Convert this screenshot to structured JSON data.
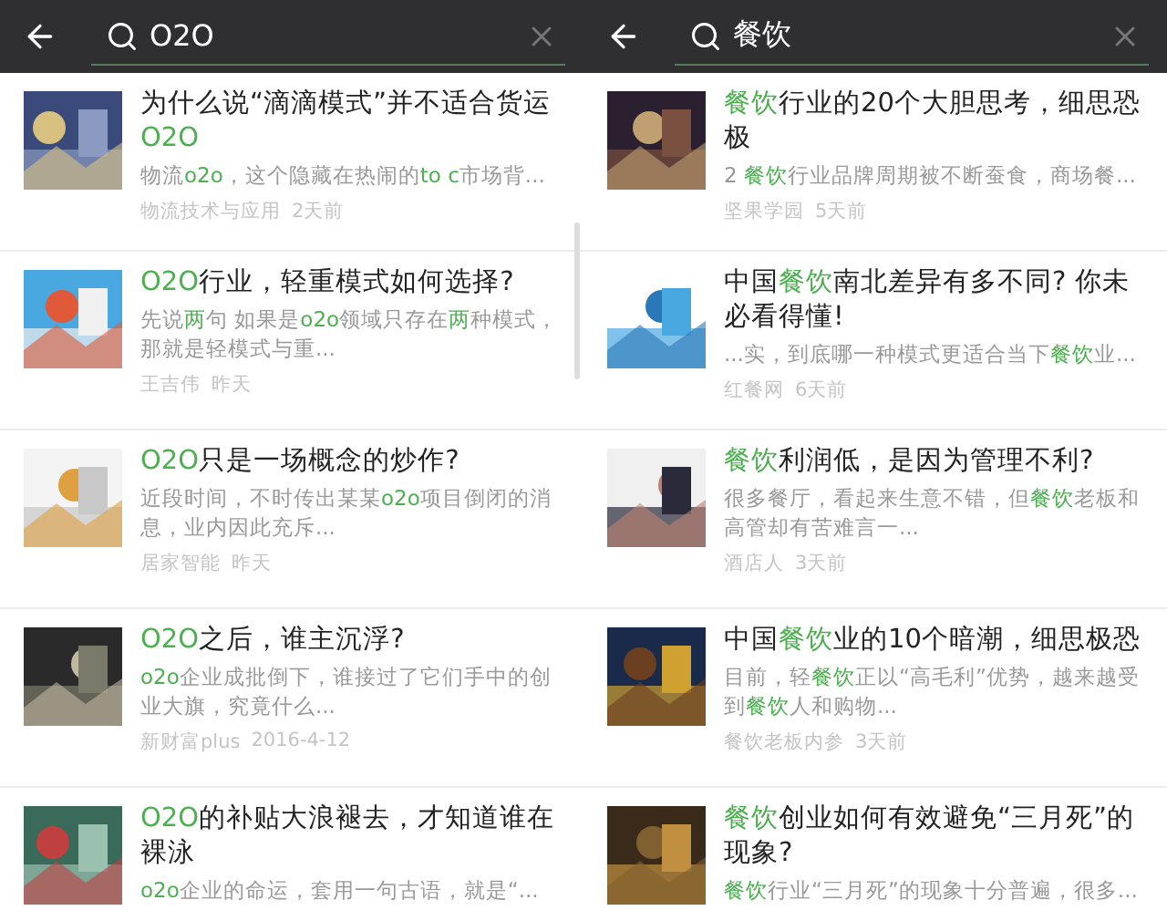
{
  "panels": [
    {
      "search": {
        "query": "O2O"
      },
      "results": [
        {
          "title": [
            {
              "text": "为什么说“滴滴模式”并不适合货运",
              "highlight": false
            },
            {
              "text": "O2O",
              "highlight": true
            }
          ],
          "snippet": [
            {
              "text": "物流",
              "highlight": false
            },
            {
              "text": "o2o",
              "highlight": true
            },
            {
              "text": "，这个隐藏在热闹的",
              "highlight": false
            },
            {
              "text": "to c",
              "highlight": true
            },
            {
              "text": "市场背...",
              "highlight": false
            }
          ],
          "source": "物流技术与应用",
          "time": "2天前"
        },
        {
          "title": [
            {
              "text": "O2O",
              "highlight": true
            },
            {
              "text": "行业，轻重模式如何选择?",
              "highlight": false
            }
          ],
          "snippet": [
            {
              "text": "先说",
              "highlight": false
            },
            {
              "text": "两",
              "highlight": true
            },
            {
              "text": "句 如果是",
              "highlight": false
            },
            {
              "text": "o2o",
              "highlight": true
            },
            {
              "text": "领域只存在",
              "highlight": false
            },
            {
              "text": "两",
              "highlight": true
            },
            {
              "text": "种模式，那就是轻模式与重...",
              "highlight": false
            }
          ],
          "source": "王吉伟",
          "time": "昨天"
        },
        {
          "title": [
            {
              "text": "O2O",
              "highlight": true
            },
            {
              "text": "只是一场概念的炒作?",
              "highlight": false
            }
          ],
          "snippet": [
            {
              "text": "近段时间，不时传出某某",
              "highlight": false
            },
            {
              "text": "o2o",
              "highlight": true
            },
            {
              "text": "项目倒闭的消息，业内因此充斥...",
              "highlight": false
            }
          ],
          "source": "居家智能",
          "time": "昨天"
        },
        {
          "title": [
            {
              "text": "O2O",
              "highlight": true
            },
            {
              "text": "之后，谁主沉浮?",
              "highlight": false
            }
          ],
          "snippet": [
            {
              "text": "o2o",
              "highlight": true
            },
            {
              "text": "企业成批倒下，谁接过了它们手中的创业大旗，究竟什么...",
              "highlight": false
            }
          ],
          "source": "新财富plus",
          "time": "2016-4-12"
        },
        {
          "title": [
            {
              "text": "O2O",
              "highlight": true
            },
            {
              "text": "的补贴大浪褪去，才知道谁在裸泳",
              "highlight": false
            }
          ],
          "snippet": [
            {
              "text": "o2o",
              "highlight": true
            },
            {
              "text": "企业的命运，套用一句古语，就是“...",
              "highlight": false
            }
          ]
        }
      ]
    },
    {
      "search": {
        "query": "餐饮"
      },
      "results": [
        {
          "title": [
            {
              "text": "餐饮",
              "highlight": true
            },
            {
              "text": "行业的20个大胆思考，细思恐极",
              "highlight": false
            }
          ],
          "snippet": [
            {
              "text": "2 ",
              "highlight": false
            },
            {
              "text": "餐饮",
              "highlight": true
            },
            {
              "text": "行业品牌周期被不断蚕食，商场餐...",
              "highlight": false
            }
          ],
          "source": "坚果学园",
          "time": "5天前"
        },
        {
          "title": [
            {
              "text": "中国",
              "highlight": false
            },
            {
              "text": "餐饮",
              "highlight": true
            },
            {
              "text": "南北差异有多不同? 你未必看得懂!",
              "highlight": false
            }
          ],
          "snippet": [
            {
              "text": "...实，到底哪一种模式更适合当下",
              "highlight": false
            },
            {
              "text": "餐饮",
              "highlight": true
            },
            {
              "text": "业...",
              "highlight": false
            }
          ],
          "source": "红餐网",
          "time": "6天前"
        },
        {
          "title": [
            {
              "text": "餐饮",
              "highlight": true
            },
            {
              "text": "利润低，是因为管理不利?",
              "highlight": false
            }
          ],
          "snippet": [
            {
              "text": "很多餐厅，看起来生意不错，但",
              "highlight": false
            },
            {
              "text": "餐饮",
              "highlight": true
            },
            {
              "text": "老板和高管却有苦难言一...",
              "highlight": false
            }
          ],
          "source": "酒店人",
          "time": "3天前"
        },
        {
          "title": [
            {
              "text": "中国",
              "highlight": false
            },
            {
              "text": "餐饮",
              "highlight": true
            },
            {
              "text": "业的10个暗潮，细思极恐",
              "highlight": false
            }
          ],
          "snippet": [
            {
              "text": "目前，轻",
              "highlight": false
            },
            {
              "text": "餐饮",
              "highlight": true
            },
            {
              "text": "正以“高毛利”优势，越来越受到",
              "highlight": false
            },
            {
              "text": "餐饮",
              "highlight": true
            },
            {
              "text": "人和购物...",
              "highlight": false
            }
          ],
          "source": "餐饮老板内参",
          "time": "3天前"
        },
        {
          "title": [
            {
              "text": "餐饮",
              "highlight": true
            },
            {
              "text": "创业如何有效避免“三月死”的现象?",
              "highlight": false
            }
          ],
          "snippet": [
            {
              "text": "餐饮",
              "highlight": true
            },
            {
              "text": "行业“三月死”的现象十分普遍，很多...",
              "highlight": false
            }
          ]
        }
      ]
    }
  ]
}
